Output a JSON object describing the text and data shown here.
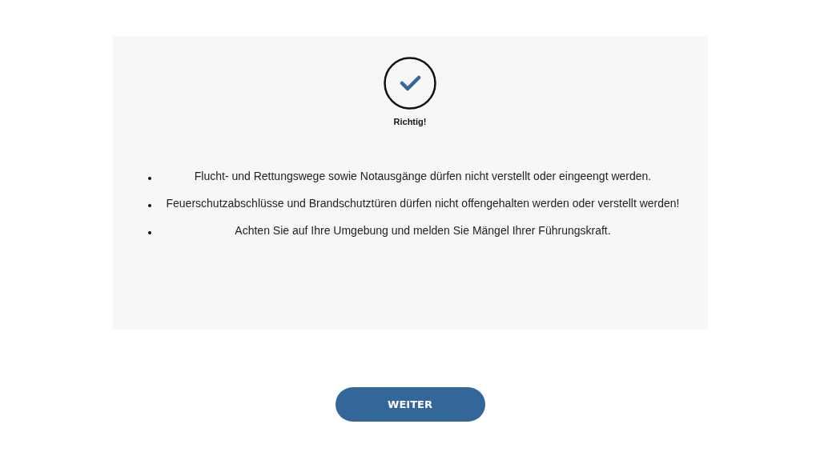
{
  "result": {
    "label": "Richtig!",
    "correct": true
  },
  "points": [
    "Flucht- und Rettungswege sowie Notausgänge dürfen nicht verstellt oder eingeengt werden.",
    "Feuerschutzabschlüsse und Brandschutztüren dürfen nicht offengehalten werden oder verstellt werden!",
    "Achten Sie auf Ihre Umgebung und melden Sie Mängel Ihrer Führungskraft."
  ],
  "button": "WEITER"
}
